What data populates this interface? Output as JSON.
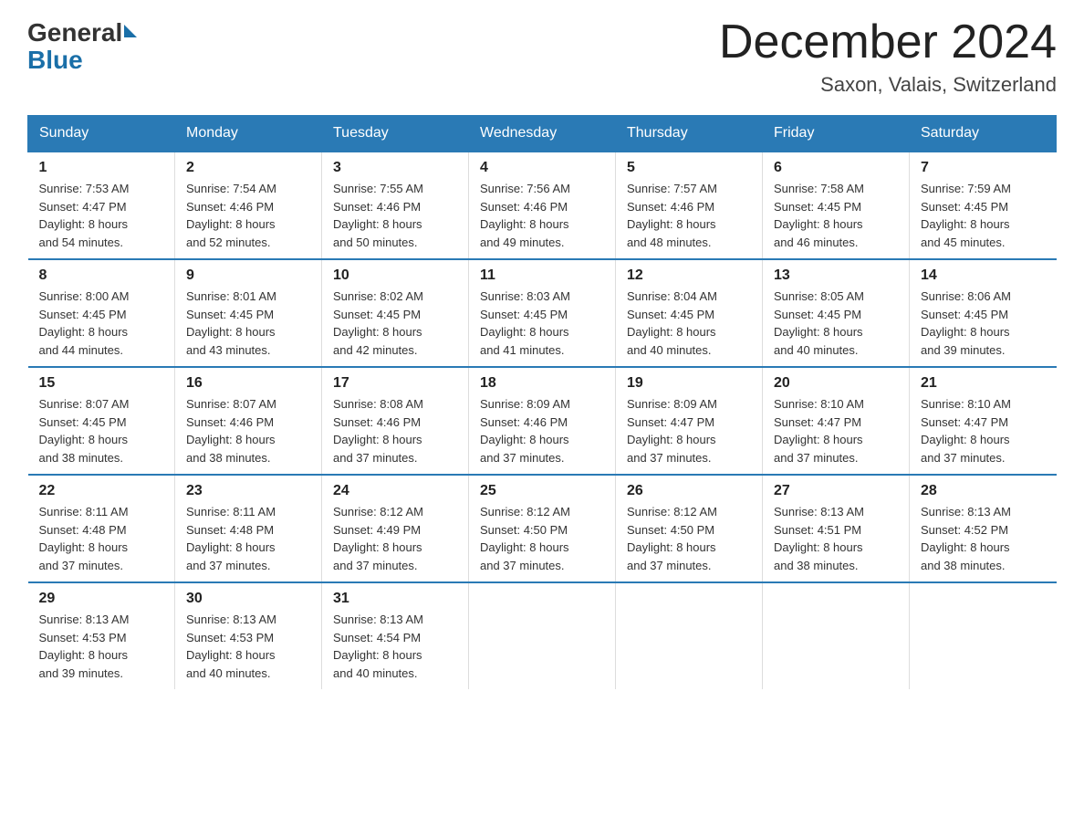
{
  "header": {
    "logo_general": "General",
    "logo_blue": "Blue",
    "month_title": "December 2024",
    "location": "Saxon, Valais, Switzerland"
  },
  "days_of_week": [
    "Sunday",
    "Monday",
    "Tuesday",
    "Wednesday",
    "Thursday",
    "Friday",
    "Saturday"
  ],
  "weeks": [
    [
      {
        "day": "1",
        "sunrise": "7:53 AM",
        "sunset": "4:47 PM",
        "daylight": "8 hours and 54 minutes."
      },
      {
        "day": "2",
        "sunrise": "7:54 AM",
        "sunset": "4:46 PM",
        "daylight": "8 hours and 52 minutes."
      },
      {
        "day": "3",
        "sunrise": "7:55 AM",
        "sunset": "4:46 PM",
        "daylight": "8 hours and 50 minutes."
      },
      {
        "day": "4",
        "sunrise": "7:56 AM",
        "sunset": "4:46 PM",
        "daylight": "8 hours and 49 minutes."
      },
      {
        "day": "5",
        "sunrise": "7:57 AM",
        "sunset": "4:46 PM",
        "daylight": "8 hours and 48 minutes."
      },
      {
        "day": "6",
        "sunrise": "7:58 AM",
        "sunset": "4:45 PM",
        "daylight": "8 hours and 46 minutes."
      },
      {
        "day": "7",
        "sunrise": "7:59 AM",
        "sunset": "4:45 PM",
        "daylight": "8 hours and 45 minutes."
      }
    ],
    [
      {
        "day": "8",
        "sunrise": "8:00 AM",
        "sunset": "4:45 PM",
        "daylight": "8 hours and 44 minutes."
      },
      {
        "day": "9",
        "sunrise": "8:01 AM",
        "sunset": "4:45 PM",
        "daylight": "8 hours and 43 minutes."
      },
      {
        "day": "10",
        "sunrise": "8:02 AM",
        "sunset": "4:45 PM",
        "daylight": "8 hours and 42 minutes."
      },
      {
        "day": "11",
        "sunrise": "8:03 AM",
        "sunset": "4:45 PM",
        "daylight": "8 hours and 41 minutes."
      },
      {
        "day": "12",
        "sunrise": "8:04 AM",
        "sunset": "4:45 PM",
        "daylight": "8 hours and 40 minutes."
      },
      {
        "day": "13",
        "sunrise": "8:05 AM",
        "sunset": "4:45 PM",
        "daylight": "8 hours and 40 minutes."
      },
      {
        "day": "14",
        "sunrise": "8:06 AM",
        "sunset": "4:45 PM",
        "daylight": "8 hours and 39 minutes."
      }
    ],
    [
      {
        "day": "15",
        "sunrise": "8:07 AM",
        "sunset": "4:45 PM",
        "daylight": "8 hours and 38 minutes."
      },
      {
        "day": "16",
        "sunrise": "8:07 AM",
        "sunset": "4:46 PM",
        "daylight": "8 hours and 38 minutes."
      },
      {
        "day": "17",
        "sunrise": "8:08 AM",
        "sunset": "4:46 PM",
        "daylight": "8 hours and 37 minutes."
      },
      {
        "day": "18",
        "sunrise": "8:09 AM",
        "sunset": "4:46 PM",
        "daylight": "8 hours and 37 minutes."
      },
      {
        "day": "19",
        "sunrise": "8:09 AM",
        "sunset": "4:47 PM",
        "daylight": "8 hours and 37 minutes."
      },
      {
        "day": "20",
        "sunrise": "8:10 AM",
        "sunset": "4:47 PM",
        "daylight": "8 hours and 37 minutes."
      },
      {
        "day": "21",
        "sunrise": "8:10 AM",
        "sunset": "4:47 PM",
        "daylight": "8 hours and 37 minutes."
      }
    ],
    [
      {
        "day": "22",
        "sunrise": "8:11 AM",
        "sunset": "4:48 PM",
        "daylight": "8 hours and 37 minutes."
      },
      {
        "day": "23",
        "sunrise": "8:11 AM",
        "sunset": "4:48 PM",
        "daylight": "8 hours and 37 minutes."
      },
      {
        "day": "24",
        "sunrise": "8:12 AM",
        "sunset": "4:49 PM",
        "daylight": "8 hours and 37 minutes."
      },
      {
        "day": "25",
        "sunrise": "8:12 AM",
        "sunset": "4:50 PM",
        "daylight": "8 hours and 37 minutes."
      },
      {
        "day": "26",
        "sunrise": "8:12 AM",
        "sunset": "4:50 PM",
        "daylight": "8 hours and 37 minutes."
      },
      {
        "day": "27",
        "sunrise": "8:13 AM",
        "sunset": "4:51 PM",
        "daylight": "8 hours and 38 minutes."
      },
      {
        "day": "28",
        "sunrise": "8:13 AM",
        "sunset": "4:52 PM",
        "daylight": "8 hours and 38 minutes."
      }
    ],
    [
      {
        "day": "29",
        "sunrise": "8:13 AM",
        "sunset": "4:53 PM",
        "daylight": "8 hours and 39 minutes."
      },
      {
        "day": "30",
        "sunrise": "8:13 AM",
        "sunset": "4:53 PM",
        "daylight": "8 hours and 40 minutes."
      },
      {
        "day": "31",
        "sunrise": "8:13 AM",
        "sunset": "4:54 PM",
        "daylight": "8 hours and 40 minutes."
      },
      {
        "day": "",
        "sunrise": "",
        "sunset": "",
        "daylight": ""
      },
      {
        "day": "",
        "sunrise": "",
        "sunset": "",
        "daylight": ""
      },
      {
        "day": "",
        "sunrise": "",
        "sunset": "",
        "daylight": ""
      },
      {
        "day": "",
        "sunrise": "",
        "sunset": "",
        "daylight": ""
      }
    ]
  ],
  "labels": {
    "sunrise": "Sunrise:",
    "sunset": "Sunset:",
    "daylight": "Daylight:"
  }
}
